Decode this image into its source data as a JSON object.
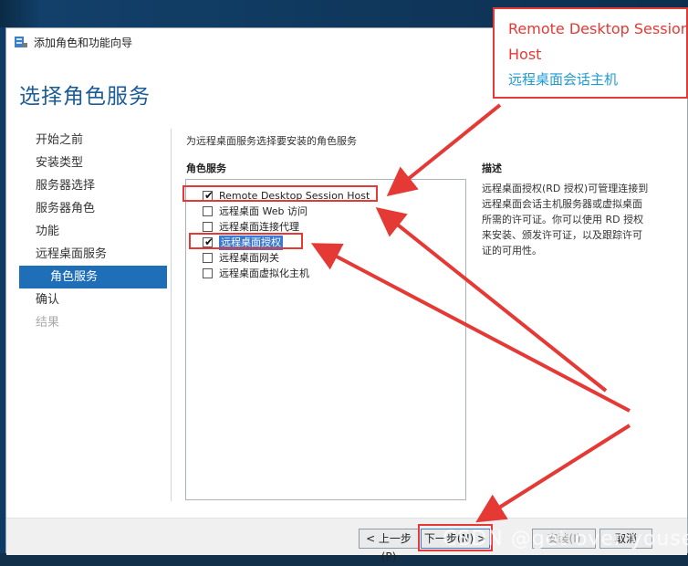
{
  "window": {
    "title": "添加角色和功能向导",
    "page_title": "选择角色服务"
  },
  "nav": {
    "items": [
      {
        "label": "开始之前"
      },
      {
        "label": "安装类型"
      },
      {
        "label": "服务器选择"
      },
      {
        "label": "服务器角色"
      },
      {
        "label": "功能"
      },
      {
        "label": "远程桌面服务"
      },
      {
        "label": "角色服务"
      },
      {
        "label": "确认"
      },
      {
        "label": "结果"
      }
    ]
  },
  "main": {
    "instruction": "为远程桌面服务选择要安装的角色服务",
    "roles_label": "角色服务",
    "description_label": "描述",
    "roles": [
      {
        "label": "Remote Desktop Session Host",
        "checked": true
      },
      {
        "label": "远程桌面 Web 访问",
        "checked": false
      },
      {
        "label": "远程桌面连接代理",
        "checked": false
      },
      {
        "label": "远程桌面授权",
        "checked": true
      },
      {
        "label": "远程桌面网关",
        "checked": false
      },
      {
        "label": "远程桌面虚拟化主机",
        "checked": false
      }
    ],
    "description": "远程桌面授权(RD 授权)可管理连接到远程桌面会话主机服务器或虚拟桌面所需的许可证。你可以使用 RD 授权来安装、颁发许可证，以及跟踪许可证的可用性。"
  },
  "footer": {
    "prev": "< 上一步(P)",
    "next": "下一步(N) >",
    "install": "安装(I)",
    "cancel": "取消"
  },
  "annotation": {
    "line1": "Remote Desktop Session",
    "line2": "Host",
    "line3": "远程桌面会话主机"
  },
  "watermark": "CSDN @get over youself",
  "colors": {
    "accent": "#1e6fb8",
    "annotation_red": "#e53935",
    "annotation_blue": "#1f9bd1"
  }
}
